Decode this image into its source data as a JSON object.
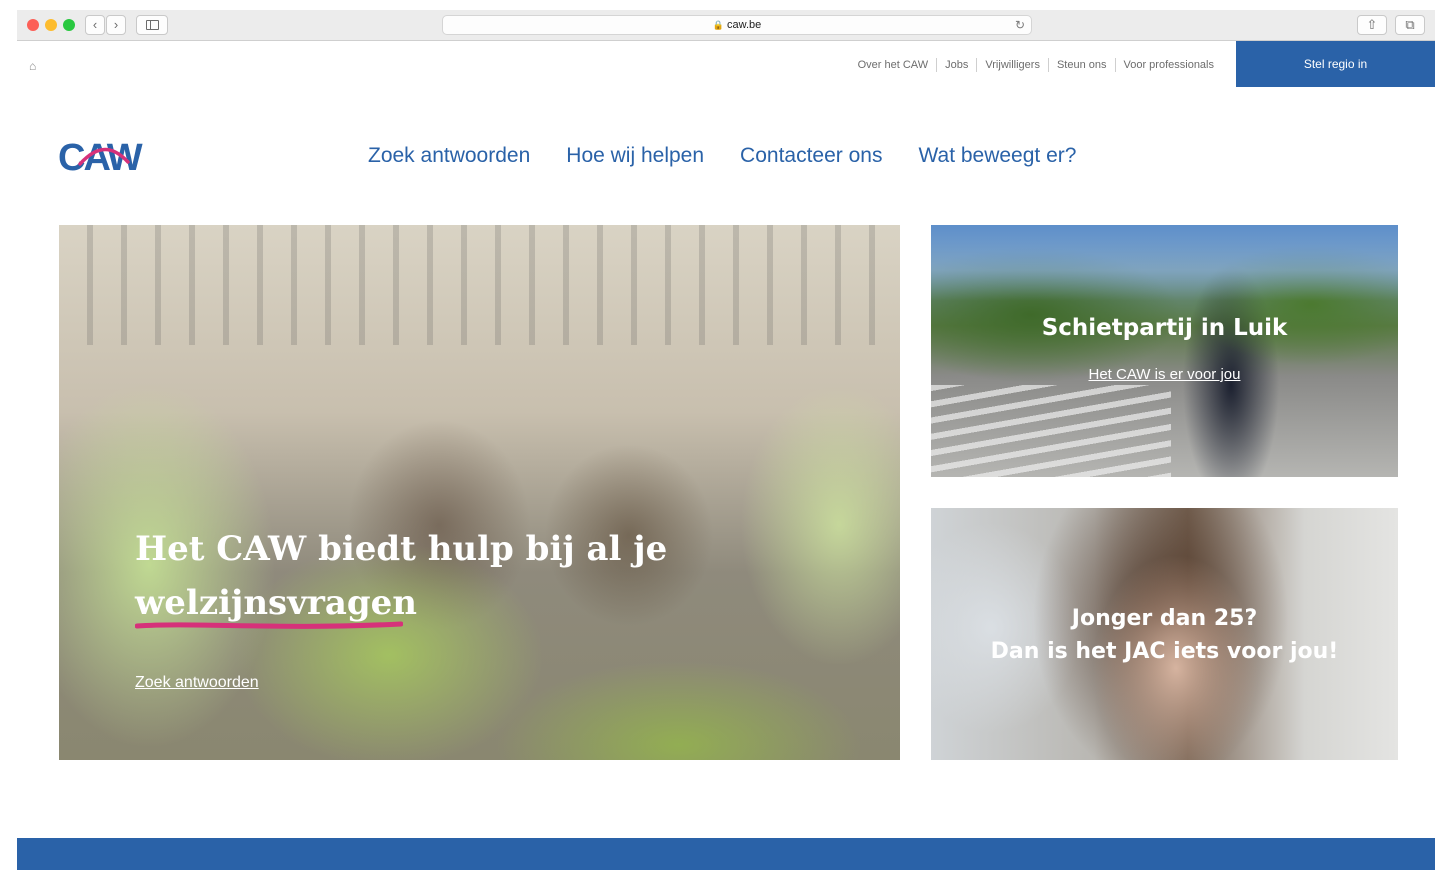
{
  "browser": {
    "url": "caw.be",
    "back_icon": "‹",
    "forward_icon": "›",
    "reload_icon": "↻",
    "share_icon": "⇧",
    "tabs_icon": "⧉",
    "lock_icon": "🔒"
  },
  "utility_nav": {
    "home_icon": "⌂",
    "links": [
      "Over het CAW",
      "Jobs",
      "Vrijwilligers",
      "Steun ons",
      "Voor professionals"
    ],
    "cta": "Stel regio in"
  },
  "logo": {
    "text": "CAW",
    "color_primary": "#2a62a8",
    "color_accent": "#d6317a"
  },
  "main_nav": [
    "Zoek antwoorden",
    "Hoe wij helpen",
    "Contacteer ons",
    "Wat beweegt er?"
  ],
  "hero": {
    "title": "Het CAW biedt hulp bij al je welzijnsvragen",
    "link": "Zoek antwoorden"
  },
  "cards": [
    {
      "title": "Schietpartij in Luik",
      "link": "Het CAW is er voor jou"
    },
    {
      "title_line1": "Jonger dan 25?",
      "title_line2": "Dan is het JAC iets voor jou!"
    }
  ],
  "colors": {
    "brand_blue": "#2a62a8",
    "accent_pink": "#d6317a"
  }
}
